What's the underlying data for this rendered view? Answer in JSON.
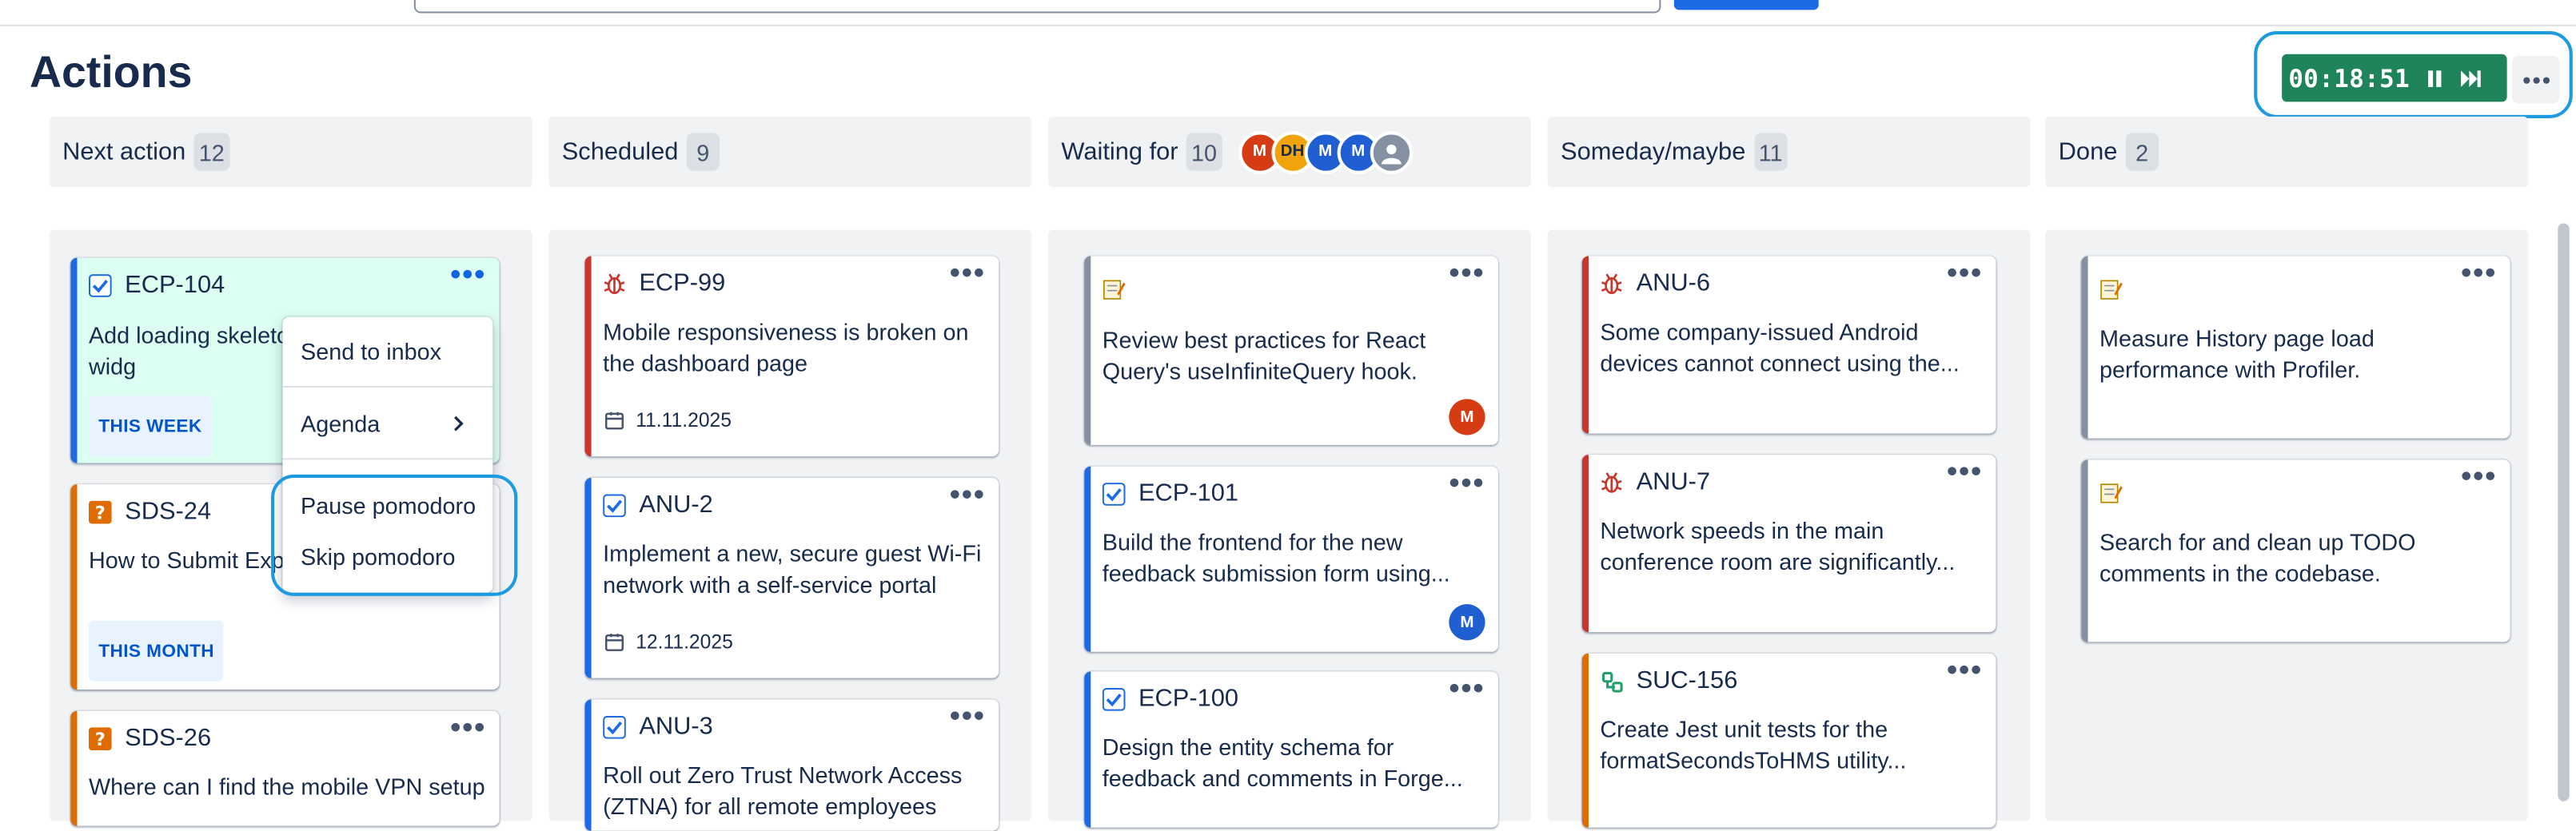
{
  "page": {
    "title": "Actions"
  },
  "timer": {
    "time": "00:18:51",
    "pause_icon": "pause-icon",
    "skip_icon": "skip-forward-icon",
    "color": "#1f845a"
  },
  "columns": [
    {
      "label": "Next action",
      "count": "12"
    },
    {
      "label": "Scheduled",
      "count": "9"
    },
    {
      "label": "Waiting for",
      "count": "10",
      "avatars": [
        "M",
        "DH",
        "M",
        "M",
        ""
      ]
    },
    {
      "label": "Someday/maybe",
      "count": "11"
    },
    {
      "label": "Done",
      "count": "2"
    }
  ],
  "cards": {
    "ecp104": {
      "key": "ECP-104",
      "summary": "Add loading skeleto the dashboard widg",
      "badge": "THIS WEEK"
    },
    "sds24": {
      "key": "SDS-24",
      "summary": "How to Submit Exp Concur System?",
      "badge": "THIS MONTH"
    },
    "sds26": {
      "key": "SDS-26",
      "summary": "Where can I find the mobile VPN setup"
    },
    "ecp99": {
      "key": "ECP-99",
      "summary": "Mobile responsiveness is broken on the dashboard page",
      "date": "11.11.2025"
    },
    "anu2": {
      "key": "ANU-2",
      "summary": "Implement a new, secure guest Wi-Fi network with a self-service portal",
      "date": "12.11.2025"
    },
    "anu3": {
      "key": "ANU-3",
      "summary": "Roll out Zero Trust Network Access (ZTNA) for all remote employees"
    },
    "wait1": {
      "summary": "Review best practices for React Query's useInfiniteQuery hook.",
      "assignee": "M"
    },
    "ecp101": {
      "key": "ECP-101",
      "summary": "Build the frontend for the new feedback submission form using...",
      "assignee": "M"
    },
    "ecp100": {
      "key": "ECP-100",
      "summary": "Design the entity schema for feedback and comments in Forge..."
    },
    "anu6": {
      "key": "ANU-6",
      "summary": "Some company-issued Android devices cannot connect using the..."
    },
    "anu7": {
      "key": "ANU-7",
      "summary": "Network speeds in the main conference room are significantly..."
    },
    "suc156": {
      "key": "SUC-156",
      "summary": "Create Jest unit tests for the formatSecondsToHMS utility..."
    },
    "done1": {
      "summary": "Measure History page load performance with Profiler."
    },
    "done2": {
      "summary": "Search for and clean up TODO comments in the codebase."
    }
  },
  "menu": {
    "items": [
      "Send to inbox",
      "Agenda",
      "Pause pomodoro",
      "Skip pomodoro"
    ]
  },
  "colors": {
    "accent": "#1d9be0",
    "task": "#1d6ae5",
    "bug": "#c9372c",
    "question": "#e06c00",
    "avatar_red": "#d63c13",
    "avatar_orange": "#f0a30a",
    "avatar_blue": "#1f5fd1"
  }
}
